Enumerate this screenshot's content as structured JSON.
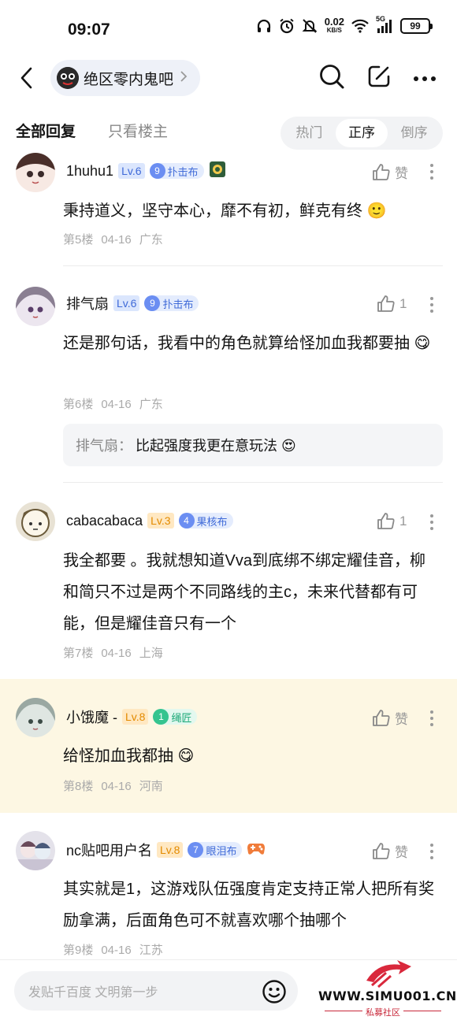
{
  "status_bar": {
    "time": "09:07",
    "net_speed": "0.02",
    "net_unit": "KB/S",
    "network": "5G",
    "battery": "99"
  },
  "nav": {
    "forum_name": "绝区零内鬼吧"
  },
  "tabs": {
    "all": "全部回复",
    "op_only": "只看楼主"
  },
  "sort": {
    "hot": "热门",
    "asc": "正序",
    "desc": "倒序",
    "active": "正序"
  },
  "posts": [
    {
      "username": "1huhu1",
      "level": "Lv.6",
      "fan_level": "9",
      "fan_title": "扑击布",
      "like": "赞",
      "text": "秉持道义，坚守本心，靡不有初，鲜克有终 🙂",
      "floor": "第5楼",
      "date": "04-16",
      "location": "广东"
    },
    {
      "username": "排气扇",
      "level": "Lv.6",
      "fan_level": "9",
      "fan_title": "扑击布",
      "like": "1",
      "text": "还是那句话，我看中的角色就算给怪加血我都要抽 😋",
      "floor": "第6楼",
      "date": "04-16",
      "location": "广东",
      "reply_author": "排气扇：",
      "reply_text": "比起强度我更在意玩法 😍"
    },
    {
      "username": "cabacabaca",
      "level": "Lv.3",
      "fan_level": "4",
      "fan_title": "果核布",
      "like": "1",
      "text": "我全都要 。我就想知道Vva到底绑不绑定耀佳音，柳和简只不过是两个不同路线的主c，未来代替都有可能，但是耀佳音只有一个",
      "floor": "第7楼",
      "date": "04-16",
      "location": "上海"
    },
    {
      "username": "小饿魔 -",
      "level": "Lv.8",
      "fan_level": "1",
      "fan_title": "绳匠",
      "like": "赞",
      "text": "给怪加血我都抽 😋",
      "floor": "第8楼",
      "date": "04-16",
      "location": "河南"
    },
    {
      "username": "nc贴吧用户名",
      "level": "Lv.8",
      "fan_level": "7",
      "fan_title": "眼泪布",
      "like": "赞",
      "text": "其实就是1，这游戏队伍强度肯定支持正常人把所有奖励拿满，后面角色可不就喜欢哪个抽哪个",
      "floor": "第9楼",
      "date": "04-16",
      "location": "江苏"
    }
  ],
  "reply_input": {
    "placeholder": "发贴千百度 文明第一步"
  },
  "watermark": {
    "url": "WWW.SIMU001.CN",
    "sub": "私募社区"
  }
}
